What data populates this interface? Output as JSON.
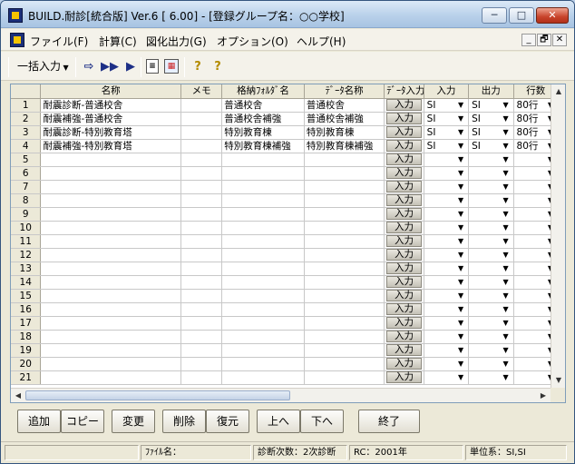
{
  "window": {
    "title": "BUILD.耐診[統合版] Ver.6 [ 6.00] - [登録グループ名：○○学校]",
    "minimize": "─",
    "maximize": "□",
    "close": "✕"
  },
  "menu": {
    "items": [
      "ファイル(F)",
      "計算(C)",
      "図化出力(G)",
      "オプション(O)",
      "ヘルプ(H)"
    ],
    "mdi": [
      "_",
      "🗗",
      "✕"
    ]
  },
  "toolbar": {
    "bulk_input": "一括入力"
  },
  "grid": {
    "columns": [
      "",
      "名称",
      "メモ",
      "格納ﾌｫﾙﾀﾞ名",
      "ﾃﾞｰﾀ名称",
      "ﾃﾞｰﾀ入力",
      "入力",
      "出力",
      "行数"
    ],
    "button_label": "入力",
    "rows": [
      {
        "num": "1",
        "name": "耐震診断-普通校舎",
        "memo": "",
        "folder": "普通校舎",
        "data": "普通校舎",
        "in": "SI",
        "out": "SI",
        "lines": "80行"
      },
      {
        "num": "2",
        "name": "耐震補強-普通校舎",
        "memo": "",
        "folder": "普通校舎補強",
        "data": "普通校舎補強",
        "in": "SI",
        "out": "SI",
        "lines": "80行"
      },
      {
        "num": "3",
        "name": "耐震診断-特別教育塔",
        "memo": "",
        "folder": "特別教育棟",
        "data": "特別教育棟",
        "in": "SI",
        "out": "SI",
        "lines": "80行"
      },
      {
        "num": "4",
        "name": "耐震補強-特別教育塔",
        "memo": "",
        "folder": "特別教育棟補強",
        "data": "特別教育棟補強",
        "in": "SI",
        "out": "SI",
        "lines": "80行"
      },
      {
        "num": "5",
        "name": "",
        "memo": "",
        "folder": "",
        "data": "",
        "in": "",
        "out": "",
        "lines": ""
      },
      {
        "num": "6",
        "name": "",
        "memo": "",
        "folder": "",
        "data": "",
        "in": "",
        "out": "",
        "lines": ""
      },
      {
        "num": "7",
        "name": "",
        "memo": "",
        "folder": "",
        "data": "",
        "in": "",
        "out": "",
        "lines": ""
      },
      {
        "num": "8",
        "name": "",
        "memo": "",
        "folder": "",
        "data": "",
        "in": "",
        "out": "",
        "lines": ""
      },
      {
        "num": "9",
        "name": "",
        "memo": "",
        "folder": "",
        "data": "",
        "in": "",
        "out": "",
        "lines": ""
      },
      {
        "num": "10",
        "name": "",
        "memo": "",
        "folder": "",
        "data": "",
        "in": "",
        "out": "",
        "lines": ""
      },
      {
        "num": "11",
        "name": "",
        "memo": "",
        "folder": "",
        "data": "",
        "in": "",
        "out": "",
        "lines": ""
      },
      {
        "num": "12",
        "name": "",
        "memo": "",
        "folder": "",
        "data": "",
        "in": "",
        "out": "",
        "lines": ""
      },
      {
        "num": "13",
        "name": "",
        "memo": "",
        "folder": "",
        "data": "",
        "in": "",
        "out": "",
        "lines": ""
      },
      {
        "num": "14",
        "name": "",
        "memo": "",
        "folder": "",
        "data": "",
        "in": "",
        "out": "",
        "lines": ""
      },
      {
        "num": "15",
        "name": "",
        "memo": "",
        "folder": "",
        "data": "",
        "in": "",
        "out": "",
        "lines": ""
      },
      {
        "num": "16",
        "name": "",
        "memo": "",
        "folder": "",
        "data": "",
        "in": "",
        "out": "",
        "lines": ""
      },
      {
        "num": "17",
        "name": "",
        "memo": "",
        "folder": "",
        "data": "",
        "in": "",
        "out": "",
        "lines": ""
      },
      {
        "num": "18",
        "name": "",
        "memo": "",
        "folder": "",
        "data": "",
        "in": "",
        "out": "",
        "lines": ""
      },
      {
        "num": "19",
        "name": "",
        "memo": "",
        "folder": "",
        "data": "",
        "in": "",
        "out": "",
        "lines": ""
      },
      {
        "num": "20",
        "name": "",
        "memo": "",
        "folder": "",
        "data": "",
        "in": "",
        "out": "",
        "lines": ""
      },
      {
        "num": "21",
        "name": "",
        "memo": "",
        "folder": "",
        "data": "",
        "in": "",
        "out": "",
        "lines": ""
      }
    ]
  },
  "buttons": {
    "add": "追加",
    "copy": "コピー",
    "change": "変更",
    "delete": "削除",
    "restore": "復元",
    "up": "上へ",
    "down": "下へ",
    "exit": "終了"
  },
  "status": {
    "filename": "ﾌｧｲﾙ名：",
    "diagnosis": "診断次数：2次診断",
    "rc": "RC：2001年",
    "unit": "単位系：SI,SI"
  },
  "colors": {
    "cell_button": "#c4c1b6",
    "close_button": "#c8432a"
  }
}
